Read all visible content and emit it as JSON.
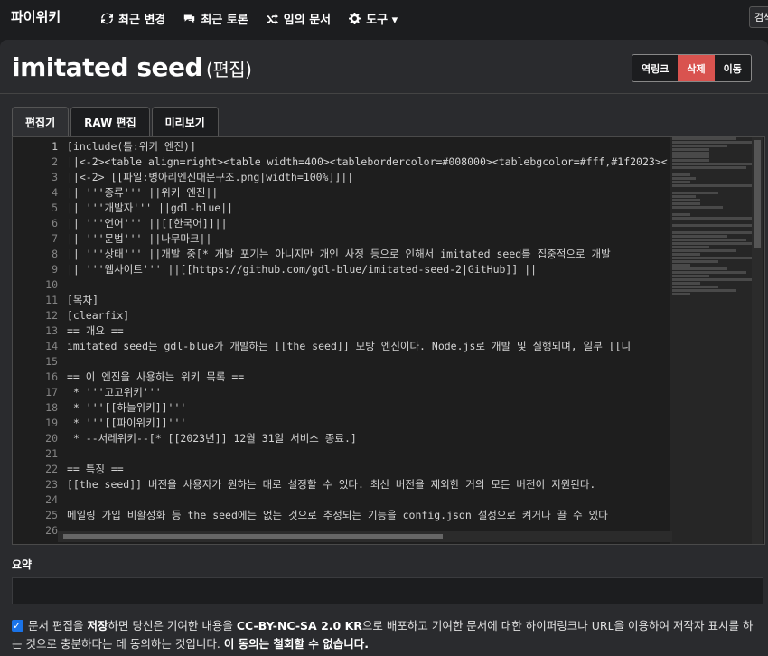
{
  "topbar": {
    "brand": "파이위키",
    "nav": [
      {
        "label": "최근 변경",
        "icon": "refresh-icon"
      },
      {
        "label": "최근 토론",
        "icon": "comments-icon"
      },
      {
        "label": "임의 문서",
        "icon": "random-icon"
      },
      {
        "label": "도구 ▾",
        "icon": "gear-icon"
      }
    ],
    "search_label": "검색"
  },
  "page": {
    "title": "imitated seed",
    "subtitle": "(편집)"
  },
  "actions": {
    "backlink": "역링크",
    "delete": "삭제",
    "move": "이동"
  },
  "colors": {
    "delete_button": "#d9534f",
    "background": "#1c1d1f",
    "card": "#2a2b2e",
    "checkbox": "#1a73e8"
  },
  "tabs": [
    {
      "label": "편집기",
      "active": true
    },
    {
      "label": "RAW 편집",
      "active": false
    },
    {
      "label": "미리보기",
      "active": false
    }
  ],
  "editor": {
    "lines": [
      {
        "n": "1",
        "text": "[include(틀:위키 엔진)]"
      },
      {
        "n": "2",
        "text": "||<-2><table align=right><table width=400><tablebordercolor=#008000><tablebgcolor=#fff,#1f2023><"
      },
      {
        "n": "3",
        "text": "||<-2> [[파일:병아리엔진대문구조.png|width=100%]]||"
      },
      {
        "n": "4",
        "text": "|| '''종류''' ||위키 엔진||"
      },
      {
        "n": "5",
        "text": "|| '''개발자''' ||gdl-blue||"
      },
      {
        "n": "6",
        "text": "|| '''언어''' ||[[한국어]]||"
      },
      {
        "n": "7",
        "text": "|| '''문법''' ||나무마크||"
      },
      {
        "n": "8",
        "text": "|| '''상태''' ||개발 중[* 개발 포기는 아니지만 개인 사정 등으로 인해서 imitated seed를 집중적으로 개발"
      },
      {
        "n": "9",
        "text": "|| '''웹사이트''' ||[[https://github.com/gdl-blue/imitated-seed-2|GitHub]] ||"
      },
      {
        "n": "10",
        "text": ""
      },
      {
        "n": "11",
        "text": "[목차]"
      },
      {
        "n": "12",
        "text": "[clearfix]"
      },
      {
        "n": "13",
        "text": "== 개요 =="
      },
      {
        "n": "14",
        "text": "imitated seed는 gdl-blue가 개발하는 [[the seed]] 모방 엔진이다. Node.js로 개발 및 실행되며, 일부 [[니"
      },
      {
        "n": "15",
        "text": ""
      },
      {
        "n": "16",
        "text": "== 이 엔진을 사용하는 위키 목록 =="
      },
      {
        "n": "17",
        "text": " * '''고고위키'''"
      },
      {
        "n": "18",
        "text": " * '''[[하늘위키]]'''"
      },
      {
        "n": "19",
        "text": " * '''[[파이위키]]'''"
      },
      {
        "n": "20",
        "text": " * --서레위키--[* [[2023년]] 12월 31일 서비스 종료.]"
      },
      {
        "n": "21",
        "text": ""
      },
      {
        "n": "22",
        "text": "== 특징 =="
      },
      {
        "n": "23",
        "text": "[[the seed]] 버전을 사용자가 원하는 대로 설정할 수 있다. 최신 버전을 제외한 거의 모든 버전이 지원된다."
      },
      {
        "n": "24",
        "text": ""
      },
      {
        "n": "25",
        "text": "메일링 가입 비활성화 등 the seed에는 없는 것으로 추정되는 기능을 config.json 설정으로 켜거나 끌 수 있다"
      },
      {
        "n": "26",
        "text": ""
      }
    ]
  },
  "summary": {
    "label": "요약",
    "value": ""
  },
  "agreement": {
    "part1": "문서 편집을 ",
    "bold1": "저장",
    "part2": "하면 당신은 기여한 내용을 ",
    "bold2": "CC-BY-NC-SA 2.0 KR",
    "part3": "으로 배포하고 기여한 문서에 대한 하이퍼링크나 URL을 이용하여 저작자 표시를 하는 것으로 충분하다는 데 동의하는 것입니다. ",
    "bold3": "이 동의는 철회할 수 없습니다.",
    "checked": true
  }
}
